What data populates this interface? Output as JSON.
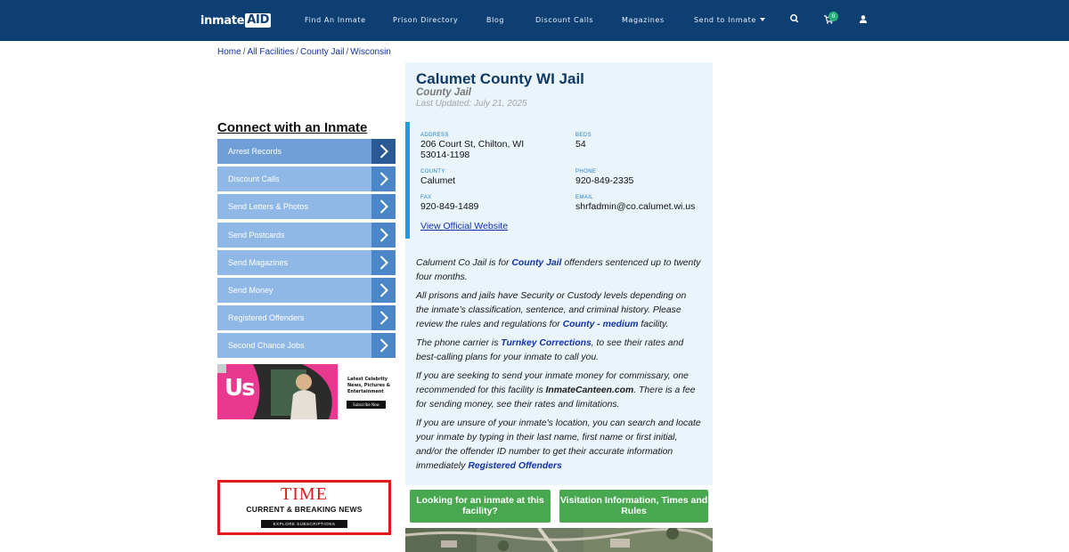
{
  "nav": {
    "logo_text": "inmate",
    "logo_box_text": "AID",
    "links": [
      "Find An Inmate",
      "Prison Directory",
      "Blog",
      "Discount Calls",
      "Magazines",
      "Send to Inmate"
    ],
    "cart_count": "0",
    "icons": [
      "search-icon",
      "cart-icon",
      "user-icon"
    ]
  },
  "breadcrumb": [
    "Home",
    "All Facilities",
    "County Jail",
    "Wisconsin"
  ],
  "sidebar": {
    "title": "Connect with an Inmate",
    "items": [
      "Arrest Records",
      "Discount Calls",
      "Send Letters & Photos",
      "Send Postcards",
      "Send Magazines",
      "Send Money",
      "Registered Offenders",
      "Second Chance Jobs"
    ]
  },
  "ads": {
    "us": {
      "logo": "Us",
      "tagline_1": "Latest Celebrity",
      "tagline_2": "News, Pictures &",
      "tagline_3": "Entertainment",
      "button": "Subscribe Now"
    },
    "time": {
      "logo": "TIME",
      "subtitle": "CURRENT & BREAKING NEWS",
      "button": "EXPLORE SUBSCRIPTIONS"
    }
  },
  "facility": {
    "title": "Calumet County WI Jail",
    "type": "County Jail",
    "updated": "Last Updated: July 21, 2025",
    "fields": {
      "address_label": "ADDRESS",
      "address_line1": "206 Court St, Chilton, WI",
      "address_line2": "53014-1198",
      "beds_label": "BEDS",
      "beds": "54",
      "county_label": "COUNTY",
      "county": "Calumet",
      "phone_label": "PHONE",
      "phone": "920-849-2335",
      "fax_label": "FAX",
      "fax": "920-849-1489",
      "email_label": "EMAIL",
      "email": "shrfadmin@co.calumet.wi.us"
    },
    "official_link": "View Official Website"
  },
  "body": {
    "p1_a": "Calument Co Jail is for ",
    "p1_link": "County Jail",
    "p1_b": " offenders sentenced up to twenty four months.",
    "p2_a": "All prisons and jails have Security or Custody levels depending on the inmate’s classification, sentence, and criminal history. Please review the rules and regulations for ",
    "p2_link": "County - medium",
    "p2_b": " facility.",
    "p3_a": "The phone carrier is ",
    "p3_link": "Turnkey Corrections",
    "p3_b": ", to see their rates and best-calling plans for your inmate to call you.",
    "p4_a": "If you are seeking to send your inmate money for commissary, one recommended for this facility is ",
    "p4_bold": "InmateCanteen.com",
    "p4_b": ". There is a fee for sending money, see their rates and limitations.",
    "p5_a": "If you are unsure of your inmate's location, you can search and locate your inmate by typing in their last name, first name or first initial, and/or the offender ID number to get their accurate information immediately ",
    "p5_link": "Registered Offenders"
  },
  "buttons": {
    "looking": "Looking for an inmate at this facility?",
    "visitation": "Visitation Information, Times and Rules"
  }
}
